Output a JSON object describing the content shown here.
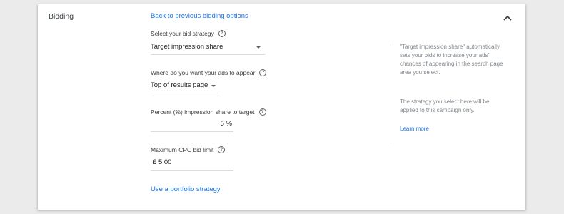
{
  "section": {
    "title": "Bidding"
  },
  "links": {
    "back": "Back to previous bidding options",
    "portfolio": "Use a portfolio strategy",
    "learn_more": "Learn more"
  },
  "fields": {
    "bid_strategy": {
      "label": "Select your bid strategy",
      "value": "Target impression share"
    },
    "ad_location": {
      "label": "Where do you want your ads to appear",
      "value": "Top of results page"
    },
    "impression_share": {
      "label": "Percent (%) impression share to target",
      "value": "5",
      "unit": "%"
    },
    "max_cpc": {
      "label": "Maximum CPC bid limit",
      "currency": "£",
      "value": "5.00"
    }
  },
  "help_panel": {
    "paragraph1": "\"Target impression share\" automatically sets your bids to increase your ads' chances of appearing in the search page area you select.",
    "paragraph2": "The strategy you select here will be applied to this campaign only."
  },
  "icons": {
    "help": "help-circle-icon",
    "collapse": "chevron-up-icon",
    "dropdown": "caret-down-icon"
  },
  "colors": {
    "link": "#1a73e8",
    "background": "#ebebeb",
    "card": "#ffffff"
  }
}
